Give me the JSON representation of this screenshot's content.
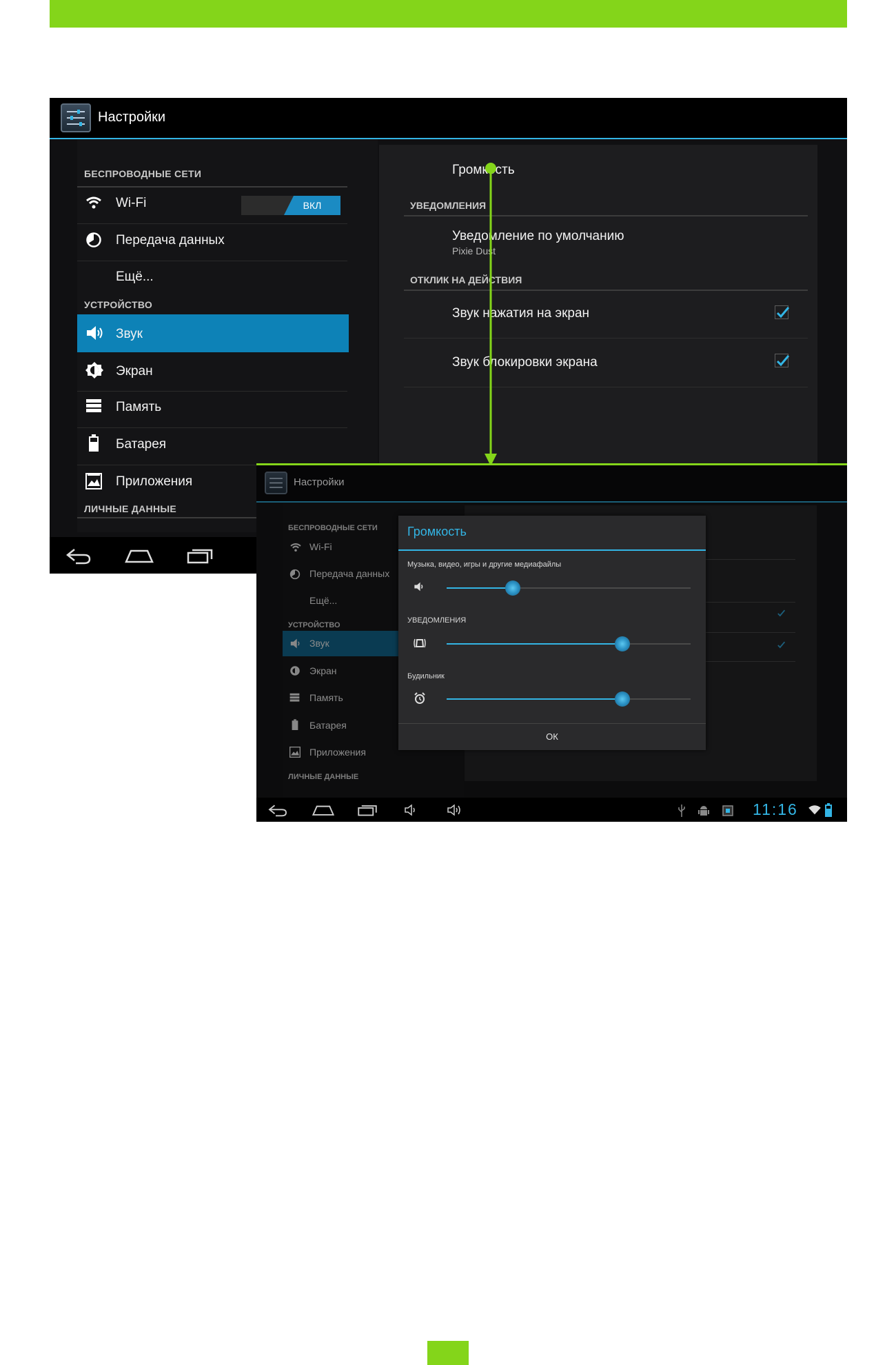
{
  "colors": {
    "accent_green": "#84d51a",
    "holo_blue": "#33b5e5",
    "selected_blue": "#0d82b7"
  },
  "screen1": {
    "title": "Настройки",
    "sidebar": {
      "wireless_header": "БЕСПРОВОДНЫЕ СЕТИ",
      "wifi_label": "Wi-Fi",
      "wifi_toggle": "ВКЛ",
      "data_usage": "Передача данных",
      "more": "Ещё...",
      "device_header": "УСТРОЙСТВО",
      "sound": "Звук",
      "display": "Экран",
      "storage": "Память",
      "battery": "Батарея",
      "apps": "Приложения",
      "personal_header": "ЛИЧНЫЕ ДАННЫЕ"
    },
    "content": {
      "volume": "Громкость",
      "notifications_header": "УВЕДОМЛЕНИЯ",
      "default_notification": "Уведомление по умолчанию",
      "default_notification_value": "Pixie Dust",
      "feedback_header": "ОТКЛИК НА ДЕЙСТВИЯ",
      "touch_sounds": "Звук нажатия на экран",
      "touch_sounds_checked": true,
      "lock_sound": "Звук блокировки экрана",
      "lock_sound_checked": true
    }
  },
  "screen2": {
    "title": "Настройки",
    "sidebar": {
      "wireless_header": "БЕСПРОВОДНЫЕ СЕТИ",
      "wifi_label": "Wi-Fi",
      "data_usage": "Передача данных",
      "more": "Ещё...",
      "device_header": "УСТРОЙСТВО",
      "sound": "Звук",
      "display": "Экран",
      "storage": "Память",
      "battery": "Батарея",
      "apps": "Приложения",
      "personal_header": "ЛИЧНЫЕ ДАННЫЕ"
    },
    "dialog": {
      "title": "Громкость",
      "media_label": "Музыка, видео, игры и другие медиафайлы",
      "media_level": 0.27,
      "notifications_label": "УВЕДОМЛЕНИЯ",
      "notifications_level": 0.72,
      "alarm_label": "Будильник",
      "alarm_level": 0.72,
      "ok": "ОК"
    },
    "status": {
      "clock": "11:16"
    }
  }
}
